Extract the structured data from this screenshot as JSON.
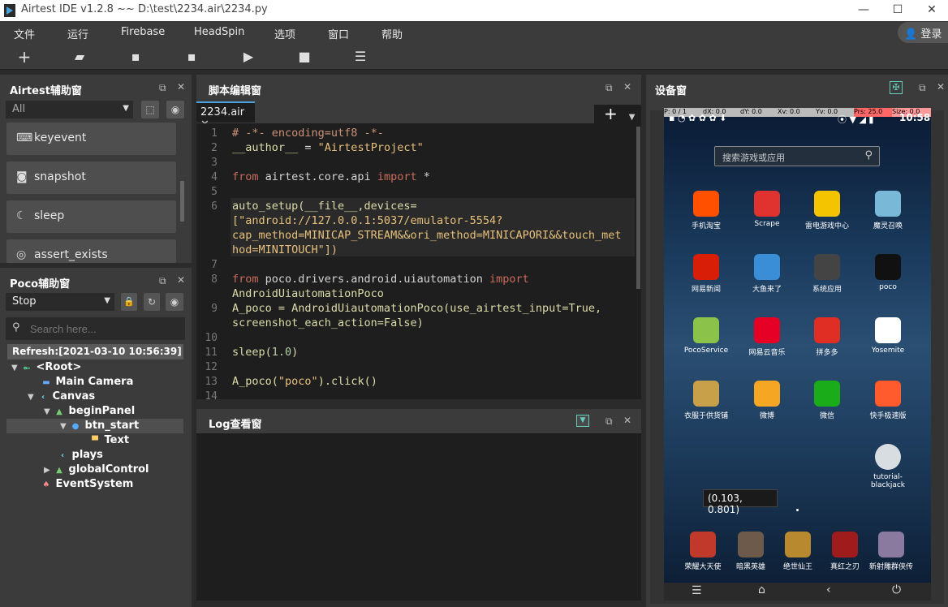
{
  "window": {
    "title": "Airtest IDE v1.2.8 ~~ D:\\test\\2234.air\\2234.py"
  },
  "menubar": {
    "items": [
      "文件",
      "运行",
      "Firebase",
      "HeadSpin",
      "选项",
      "窗口",
      "帮助"
    ],
    "login": "登录"
  },
  "airtest_panel": {
    "title": "Airtest辅助窗",
    "filter_value": "All",
    "commands": [
      "keyevent",
      "snapshot",
      "sleep",
      "assert_exists"
    ]
  },
  "poco_panel": {
    "title": "Poco辅助窗",
    "mode_value": "Stop",
    "search_placeholder": "Search here...",
    "refresh_text": "Refresh:[2021-03-10 10:56:39]",
    "tree": [
      {
        "label": "<Root>",
        "icon": "node-icon"
      },
      {
        "label": "Main Camera",
        "icon": "camera-icon"
      },
      {
        "label": "Canvas",
        "icon": "canvas-icon"
      },
      {
        "label": "beginPanel",
        "icon": "image-icon"
      },
      {
        "label": "btn_start",
        "icon": "button-icon"
      },
      {
        "label": "Text",
        "icon": "text-icon"
      },
      {
        "label": "plays",
        "icon": "canvas-icon"
      },
      {
        "label": "globalControl",
        "icon": "image-icon"
      },
      {
        "label": "EventSystem",
        "icon": "eventsystem-icon"
      }
    ]
  },
  "editor": {
    "title": "脚本编辑窗",
    "tab": "2234.air",
    "line_numbers": [
      "1",
      "2",
      "3",
      "4",
      "5",
      "6",
      "7",
      "8",
      "9",
      "10",
      "11",
      "12",
      "13",
      "14"
    ],
    "code": {
      "l1": "# -*- encoding=utf8 -*-",
      "l2a": "__author__",
      "l2b": " = ",
      "l2c": "\"AirtestProject\"",
      "l4a": "from",
      "l4b": " airtest.core.api ",
      "l4c": "import",
      "l4d": " *",
      "l6a": "auto_setup(__file__,devices=",
      "l6b": "[\"android://127.0.0.1:5037/emulator-5554?",
      "l6c": "cap_method=MINICAP_STREAM&&ori_method=MINICAPORI&&touch_met",
      "l6d": "hod=MINITOUCH\"])",
      "l8a": "from",
      "l8b": " poco.drivers.android.uiautomation ",
      "l8c": "import",
      "l8d": "AndroidUiautomationPoco",
      "l9a": "A_poco = AndroidUiautomationPoco(use_airtest_input=True,",
      "l9b": "screenshot_each_action=False)",
      "l11a": "sleep(",
      "l11b": "1.0",
      "l11c": ")",
      "l13a": "A_poco(",
      "l13b": "\"poco\"",
      "l13c": ").click()"
    }
  },
  "log_panel": {
    "title": "Log查看窗"
  },
  "device_panel": {
    "title": "设备窗",
    "status": {
      "p": "P: 0 / 1",
      "dx": "dX: 0.0",
      "dy": "dY: 0.0",
      "xv": "Xv: 0.0",
      "yv": "Yv: 0.0",
      "prs": "Prs: 25.0",
      "size": "Size: 0.0"
    },
    "clock": "10:58",
    "search_placeholder": "搜索游戏或应用",
    "apps_row1": [
      "手机淘宝",
      "Scrape",
      "雷电游戏中心",
      "魔灵召唤"
    ],
    "apps_row2": [
      "网易新闻",
      "大鱼来了",
      "系统应用",
      "poco"
    ],
    "apps_row3": [
      "PocoService",
      "网易云音乐",
      "拼多多",
      "Yosemite"
    ],
    "apps_row4": [
      "衣服于供货铺",
      "微博",
      "微信",
      "快手极速版"
    ],
    "apps_row5": [
      "tutorial-blackjack"
    ],
    "coordinate_tooltip": "(0.103, 0.801)",
    "dock": [
      "荣耀大天使",
      "暗黑英雄",
      "绝世仙王",
      "真红之刃",
      "新射雕群侠传"
    ]
  },
  "colors": {
    "accent": "#4aa3df",
    "app_bg": "#3b3b3b",
    "editor_bg": "#1e1e1e"
  }
}
